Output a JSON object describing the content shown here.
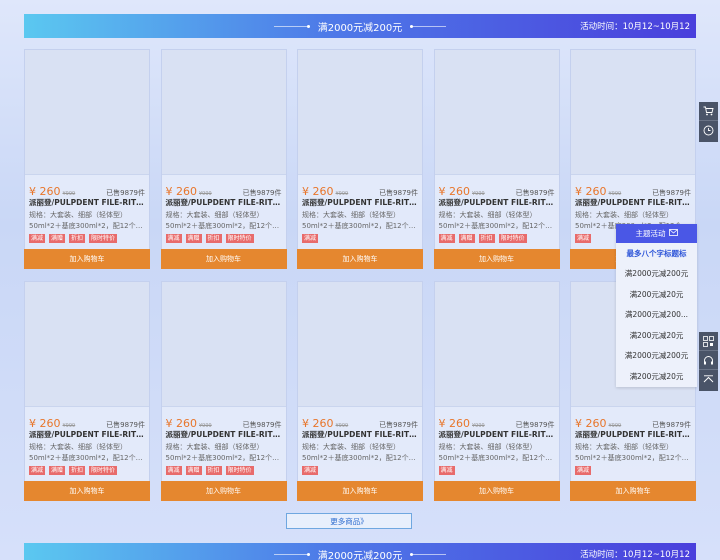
{
  "banner_top": {
    "title": "满2000元减200元",
    "time": "活动时间：10月12~10月12"
  },
  "banner_bottom": {
    "title": "满2000元减200元",
    "time": "活动时间：10月12~10月12"
  },
  "product": {
    "price": "¥ 260",
    "orig_price": "¥999",
    "sold": "已售9879件",
    "name": "派丽登/PULPDENT FILE-RITETM...",
    "spec1": "规格：大套装、细部（轻体型）",
    "spec2": "50ml*2＋基底300ml*2，配12个混...",
    "cart_label": "加入购物车"
  },
  "tags": {
    "full": [
      "满减",
      "满赠",
      "折扣",
      "限时特价"
    ],
    "single": [
      "满减"
    ]
  },
  "more_button": "更多商品》",
  "float_menu": {
    "header": "主题活动",
    "items": [
      "最多八个字标题标",
      "满2000元减200元",
      "满200元减20元",
      "满2000元减200...",
      "满200元减20元",
      "满2000元减200元",
      "满200元减20元"
    ]
  },
  "side_tools": [
    "cart-icon",
    "clock-icon",
    "qrcode-icon",
    "headset-icon",
    "back-to-top-icon"
  ]
}
